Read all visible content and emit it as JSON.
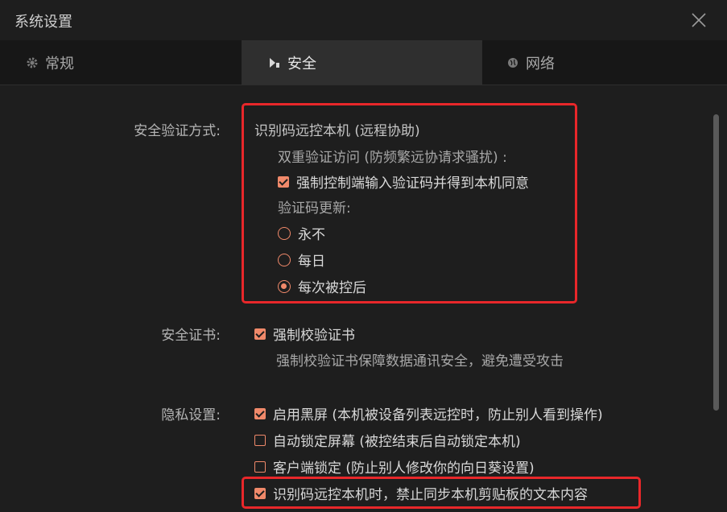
{
  "window": {
    "title": "系统设置"
  },
  "tabs": [
    {
      "label": "常规",
      "icon": "gear-icon"
    },
    {
      "label": "安全",
      "icon": "shield-icon"
    },
    {
      "label": "网络",
      "icon": "globe-icon"
    }
  ],
  "security_verification": {
    "label": "安全验证方式:",
    "mode": "识别码远控本机 (远程协助)",
    "two_factor_label": "双重验证访问 (防频繁远协请求骚扰) :",
    "force_code_option": "强制控制端输入验证码并得到本机同意",
    "force_code_checked": true,
    "code_update_label": "验证码更新:",
    "code_update_options": [
      "永不",
      "每日",
      "每次被控后"
    ],
    "code_update_selected": "每次被控后"
  },
  "certificate": {
    "label": "安全证书:",
    "option": "强制校验证书",
    "checked": true,
    "description": "强制校验证书保障数据通讯安全，避免遭受攻击"
  },
  "privacy": {
    "label": "隐私设置:",
    "options": [
      {
        "text": "启用黑屏 (本机被设备列表远控时，防止别人看到操作)",
        "checked": true
      },
      {
        "text": "自动锁定屏幕 (被控结束后自动锁定本机)",
        "checked": false
      },
      {
        "text": "客户端锁定 (防止别人修改你的向日葵设置)",
        "checked": false
      },
      {
        "text": "识别码远控本机时，禁止同步本机剪贴板的文本内容",
        "checked": true
      }
    ]
  },
  "colors": {
    "accent": "#f0896a",
    "highlight": "#e8272a",
    "background": "#1e1e1e"
  }
}
